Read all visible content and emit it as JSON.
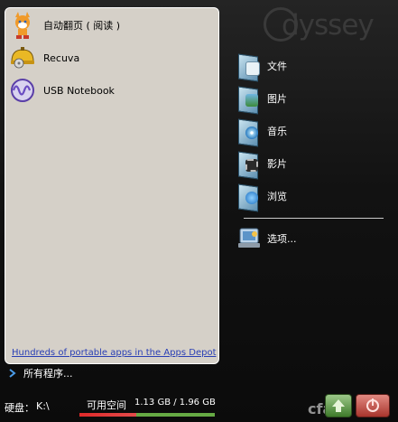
{
  "brand": {
    "logo_text": "dyssey"
  },
  "apps": [
    {
      "label": "自动翻页 ( 阅读 )",
      "icon": "fox-mascot-icon"
    },
    {
      "label": "Recuva",
      "icon": "recuva-helmet-icon"
    },
    {
      "label": "USB Notebook",
      "icon": "usb-notebook-icon"
    }
  ],
  "portable_link": "Hundreds of portable apps in the Apps Depot",
  "all_programs": "所有程序...",
  "folders": [
    {
      "label": "文件",
      "icon": "documents-folder-icon"
    },
    {
      "label": "图片",
      "icon": "pictures-folder-icon"
    },
    {
      "label": "音乐",
      "icon": "music-folder-icon"
    },
    {
      "label": "影片",
      "icon": "videos-folder-icon"
    },
    {
      "label": "浏览",
      "icon": "explore-folder-icon"
    }
  ],
  "options_label": "选项...",
  "disk": {
    "label": "硬盘：",
    "drive": "K:\\",
    "space_label": "可用空间",
    "space_value": "1.13 GB / 1.96 GB",
    "used_fraction": 0.42
  },
  "watermark": "cfan",
  "colors": {
    "used_bar": "#e02a2a",
    "free_bar": "#66aa44",
    "link": "#2a3fb5"
  }
}
